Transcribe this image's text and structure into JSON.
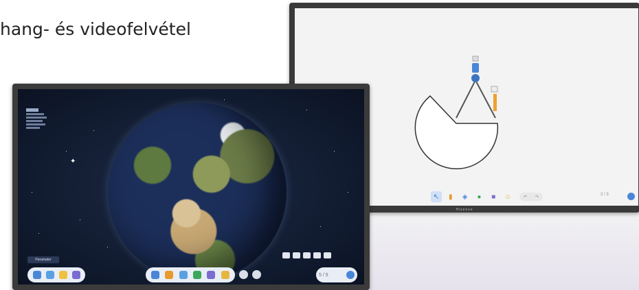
{
  "headline": "hang- és videofelvétel",
  "right_display": {
    "brand": "Hisense",
    "page_indicator": "2 / 3",
    "toolbar_tools": [
      "select-icon",
      "pen-icon",
      "eraser-icon",
      "shape-icon",
      "compass-tool-icon",
      "more-icon"
    ],
    "accent_color": "#4a86d8"
  },
  "left_display": {
    "param_button": "Paramater",
    "page_indicator": "5 / 5",
    "dock_left_icons": [
      "menu-icon",
      "globe-icon",
      "folder-icon",
      "document-icon"
    ],
    "dock_mid_icons": [
      "select-icon",
      "pen-icon",
      "eraser-icon",
      "shape-icon",
      "color-icon",
      "more-icon"
    ]
  }
}
